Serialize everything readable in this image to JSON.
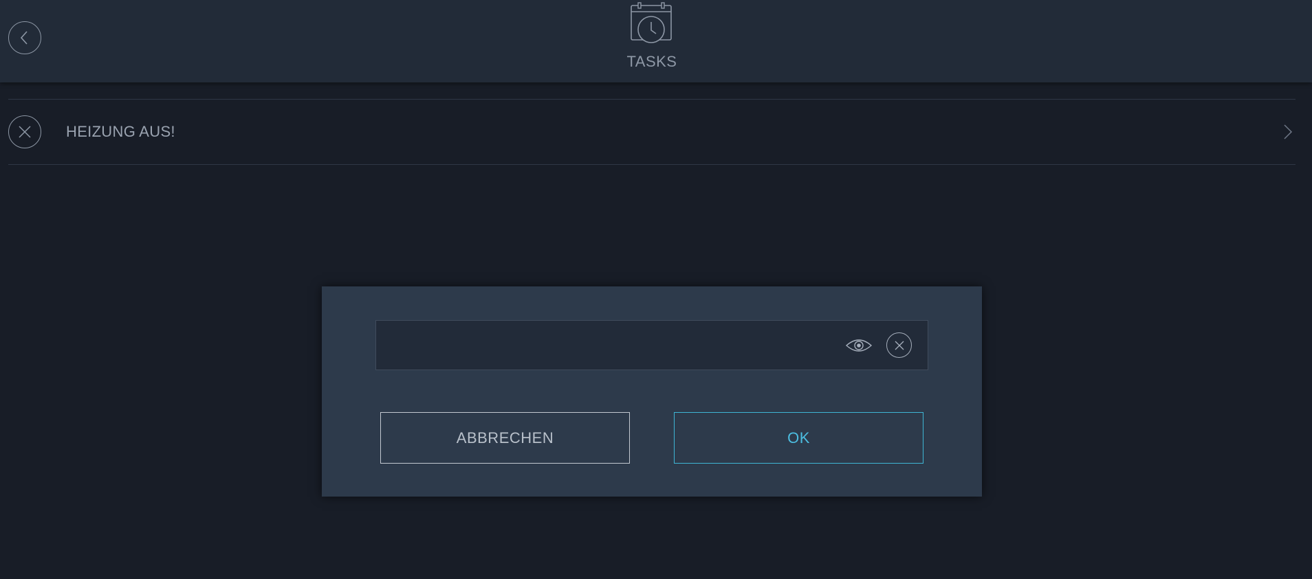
{
  "header": {
    "title": "TASKS",
    "back_icon": "chevron-left-icon",
    "app_icon": "calendar-clock-icon"
  },
  "tasks": {
    "items": [
      {
        "label": "HEIZUNG AUS!",
        "status_icon": "close-icon",
        "nav_icon": "chevron-right-icon"
      }
    ]
  },
  "dialog": {
    "input": {
      "value": "",
      "placeholder": ""
    },
    "reveal_icon": "eye-icon",
    "clear_icon": "close-icon",
    "cancel_label": "ABBRECHEN",
    "ok_label": "OK"
  },
  "colors": {
    "background": "#181d27",
    "header": "#222b38",
    "dialog": "#2d3a4b",
    "accent": "#4cbde0",
    "text_muted": "#8e98a6"
  }
}
